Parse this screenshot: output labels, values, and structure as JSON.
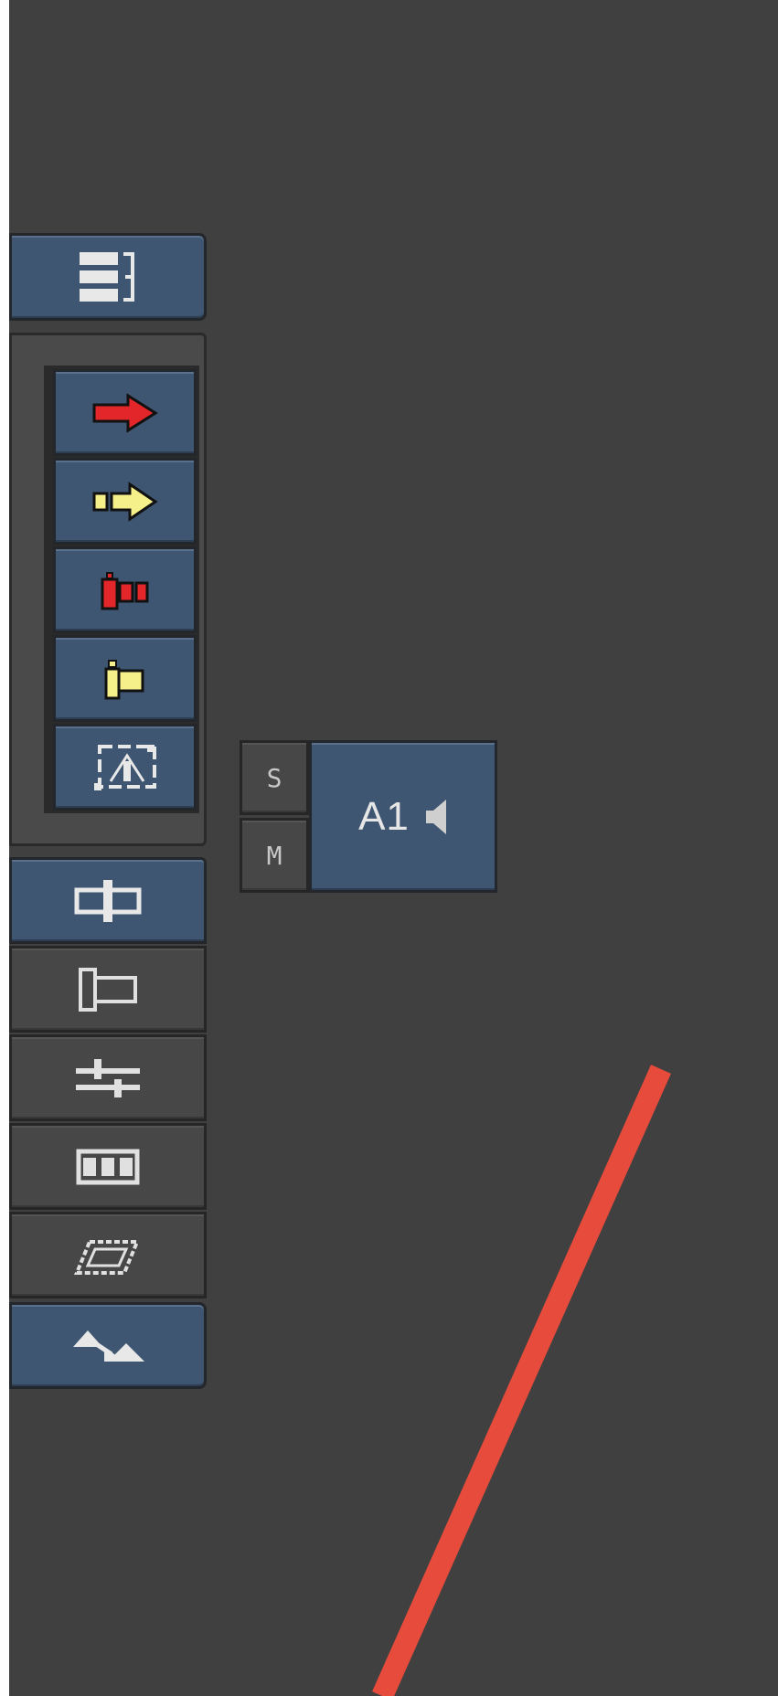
{
  "track": {
    "name": "A1",
    "solo_label": "S",
    "mute_label": "M"
  },
  "icons": {
    "top": "track-list-icon",
    "group": [
      "red-arrow-icon",
      "yellow-arrow-icon",
      "red-segment-icon",
      "yellow-segment-icon",
      "selection-box-icon"
    ],
    "lower": [
      "split-clip-icon",
      "clip-icon",
      "sliders-icon",
      "filmstrip-icon",
      "film-slant-icon"
    ],
    "bottom": "triangles-icon",
    "speaker": "speaker-icon"
  },
  "colors": {
    "background": "#404040",
    "button_blue": "#3e5671",
    "button_gray": "#474747",
    "red_arrow": "#e2262a",
    "yellow_arrow": "#f6f08a",
    "annotation_line": "#e74b3c"
  }
}
